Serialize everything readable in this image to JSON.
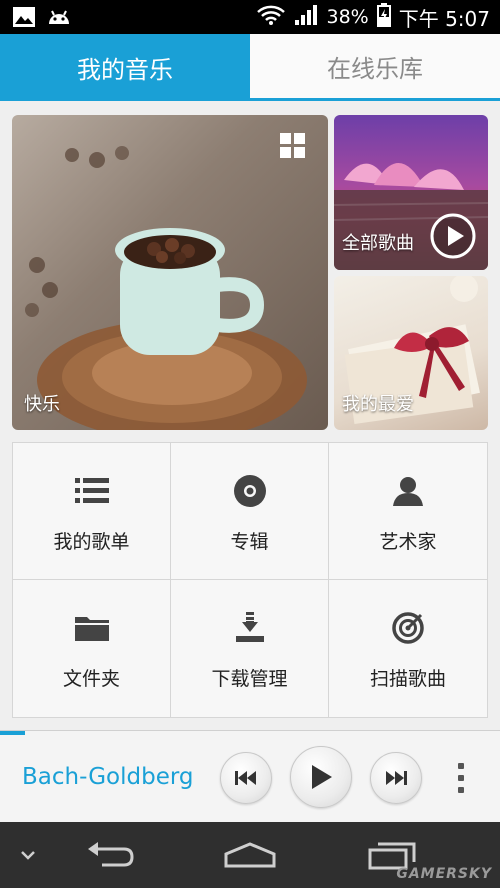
{
  "status_bar": {
    "battery": "38%",
    "time": "下午 5:07",
    "icons": [
      "image-icon",
      "android-icon",
      "wifi-icon",
      "signal-icon",
      "battery-icon"
    ]
  },
  "tabs": [
    {
      "label": "我的音乐",
      "active": true
    },
    {
      "label": "在线乐库",
      "active": false
    }
  ],
  "tiles": {
    "main": "快乐",
    "all_songs": "全部歌曲",
    "favorites": "我的最爱"
  },
  "menu": [
    {
      "label": "我的歌单",
      "icon": "list-icon"
    },
    {
      "label": "专辑",
      "icon": "disc-icon"
    },
    {
      "label": "艺术家",
      "icon": "person-icon"
    },
    {
      "label": "文件夹",
      "icon": "folder-icon"
    },
    {
      "label": "下载管理",
      "icon": "download-icon"
    },
    {
      "label": "扫描歌曲",
      "icon": "scan-icon"
    }
  ],
  "player": {
    "song": "Bach-Goldberg",
    "progress": 0.05
  },
  "navbar": {
    "icons": [
      "collapse-icon",
      "back-icon",
      "home-icon",
      "recent-apps-icon"
    ]
  },
  "watermark": "GAMERSKY",
  "colors": {
    "accent": "#1aa0d6",
    "statusbar": "#000000",
    "navbar": "#2f2f2f"
  }
}
